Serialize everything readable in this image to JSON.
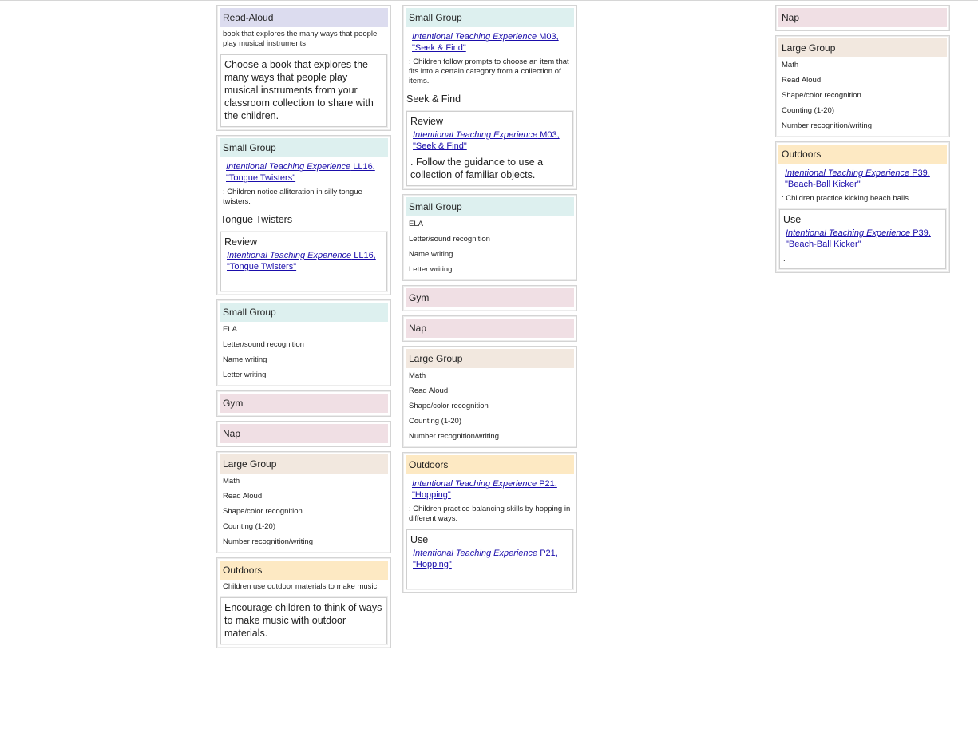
{
  "col1": {
    "read_aloud": {
      "header": "Read-Aloud",
      "desc": "book that explores the many ways that people play musical instruments",
      "box": "Choose a book that explores the many ways that people play musical instruments from your classroom collection to share with the children."
    },
    "small_group_1": {
      "header": "Small Group",
      "link_italic": "Intentional Teaching Experience",
      "link_rest": " LL16, \"Tongue Twisters\"",
      "desc": ": Children notice alliteration in silly tongue twisters.",
      "subtitle": "Tongue Twisters",
      "box_title": "Review",
      "box_link_italic": "Intentional Teaching Experience",
      "box_link_rest": " LL16, \"Tongue Twisters\"",
      "box_tail": "."
    },
    "small_group_2": {
      "header": "Small Group",
      "items": [
        "ELA",
        "Letter/sound recognition",
        "Name writing",
        "Letter writing"
      ]
    },
    "gym": {
      "header": "Gym"
    },
    "nap": {
      "header": "Nap"
    },
    "large_group": {
      "header": "Large Group",
      "items": [
        "Math",
        "Read Aloud",
        "Shape/color recognition",
        "Counting (1-20)",
        "Number recognition/writing"
      ]
    },
    "outdoors": {
      "header": "Outdoors",
      "desc": "Children use outdoor materials to make music.",
      "box": "Encourage children to think of ways to make music with outdoor materials."
    }
  },
  "col2": {
    "small_group_1": {
      "header": "Small Group",
      "link_italic": "Intentional Teaching Experience",
      "link_rest": " M03, \"Seek & Find\"",
      "desc": ": Children follow prompts to choose an item that fits into a certain category from a collection of items.",
      "subtitle": "Seek & Find",
      "box_title": "Review",
      "box_link_italic": "Intentional Teaching Experience",
      "box_link_rest": " M03, \"Seek & Find\"",
      "box_tail": ". Follow the guidance to use a collection of familiar objects."
    },
    "small_group_2": {
      "header": "Small Group",
      "items": [
        "ELA",
        "Letter/sound recognition",
        "Name writing",
        "Letter writing"
      ]
    },
    "gym": {
      "header": "Gym"
    },
    "nap": {
      "header": "Nap"
    },
    "large_group": {
      "header": "Large Group",
      "items": [
        "Math",
        "Read Aloud",
        "Shape/color recognition",
        "Counting (1-20)",
        "Number recognition/writing"
      ]
    },
    "outdoors": {
      "header": "Outdoors",
      "link_italic": "Intentional Teaching Experience",
      "link_rest": " P21, \"Hopping\"",
      "desc": ": Children practice balancing skills by hopping in different ways.",
      "box_title": "Use",
      "box_link_italic": "Intentional Teaching Experience",
      "box_link_rest": " P21, \"Hopping\"",
      "box_tail": "."
    }
  },
  "col3": {
    "nap": {
      "header": "Nap"
    },
    "large_group": {
      "header": "Large Group",
      "items": [
        "Math",
        "Read Aloud",
        "Shape/color recognition",
        "Counting (1-20)",
        "Number recognition/writing"
      ]
    },
    "outdoors": {
      "header": "Outdoors",
      "link_italic": "Intentional Teaching Experience",
      "link_rest": " P39, \"Beach-Ball Kicker\"",
      "desc": ": Children practice kicking beach balls.",
      "box_title": "Use",
      "box_link_italic": "Intentional Teaching Experience",
      "box_link_rest": " P39, \"Beach-Ball Kicker\"",
      "box_tail": "."
    }
  }
}
